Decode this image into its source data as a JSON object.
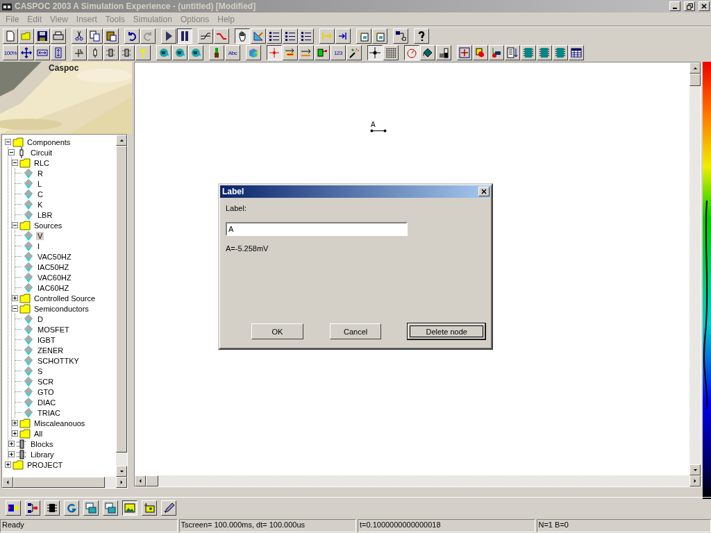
{
  "window": {
    "title": "CASPOC 2003 A Simulation Experience - (untitled) [Modified]"
  },
  "menu": [
    "File",
    "Edit",
    "View",
    "Insert",
    "Tools",
    "Simulation",
    "Options",
    "Help"
  ],
  "toolbar_rows": [
    {
      "groups": [
        {
          "buttons": [
            {
              "pressed": false
            },
            {
              "pressed": false
            },
            {
              "pressed": false
            },
            {
              "pressed": false
            }
          ]
        },
        {
          "buttons": [
            {
              "pressed": false
            },
            {
              "pressed": false
            },
            {
              "pressed": false
            }
          ]
        },
        {
          "buttons": [
            {
              "pressed": false
            },
            {
              "pressed": false
            }
          ]
        },
        {
          "buttons": [
            {
              "pressed": false
            },
            {
              "pressed": true
            }
          ]
        },
        {
          "buttons": [
            {
              "pressed": false
            },
            {
              "pressed": false
            }
          ]
        },
        {
          "buttons": [
            {
              "pressed": true
            },
            {
              "pressed": false
            },
            {
              "pressed": false
            },
            {
              "pressed": false
            },
            {
              "pressed": false
            }
          ]
        },
        {
          "buttons": [
            {
              "pressed": false
            },
            {
              "pressed": false
            }
          ]
        },
        {
          "buttons": [
            {
              "pressed": false
            },
            {
              "pressed": false
            }
          ]
        },
        {
          "buttons": [
            {
              "pressed": false
            }
          ]
        },
        {
          "buttons": [
            {
              "pressed": false
            }
          ]
        }
      ]
    },
    {
      "groups": [
        {
          "buttons": [
            {
              "pressed": false,
              "label": "100%"
            },
            {
              "pressed": false
            },
            {
              "pressed": false
            },
            {
              "pressed": false
            }
          ]
        },
        {
          "buttons": [
            {
              "pressed": false
            },
            {
              "pressed": false
            },
            {
              "pressed": false
            },
            {
              "pressed": false
            },
            {
              "pressed": false
            }
          ]
        },
        {
          "buttons": [
            {
              "pressed": false
            },
            {
              "pressed": false
            },
            {
              "pressed": false
            }
          ]
        },
        {
          "buttons": [
            {
              "pressed": false
            },
            {
              "pressed": false,
              "label": "Abc"
            }
          ]
        },
        {
          "buttons": [
            {
              "pressed": false
            }
          ]
        },
        {
          "buttons": [
            {
              "pressed": true
            },
            {
              "pressed": false
            },
            {
              "pressed": false
            },
            {
              "pressed": false
            },
            {
              "pressed": false,
              "label": "123"
            },
            {
              "pressed": false
            }
          ]
        },
        {
          "buttons": [
            {
              "pressed": true
            },
            {
              "pressed": false
            }
          ]
        },
        {
          "buttons": [
            {
              "pressed": true
            },
            {
              "pressed": false
            },
            {
              "pressed": false
            }
          ]
        },
        {
          "buttons": [
            {
              "pressed": false
            },
            {
              "pressed": false
            },
            {
              "pressed": false
            },
            {
              "pressed": false
            },
            {
              "pressed": false
            },
            {
              "pressed": false
            },
            {
              "pressed": false
            },
            {
              "pressed": false
            }
          ]
        }
      ]
    }
  ],
  "sidebar": {
    "title": "Caspoc",
    "tree": [
      {
        "label": "Components",
        "kind": "folder",
        "expanded": true,
        "selected": false,
        "children": [
          {
            "label": "Circuit",
            "kind": "circuit",
            "expanded": true,
            "selected": false,
            "children": [
              {
                "label": "RLC",
                "kind": "folder",
                "expanded": true,
                "selected": false,
                "children": [
                  {
                    "label": "R",
                    "kind": "component",
                    "selected": false
                  },
                  {
                    "label": "L",
                    "kind": "component",
                    "selected": false
                  },
                  {
                    "label": "C",
                    "kind": "component",
                    "selected": false
                  },
                  {
                    "label": "K",
                    "kind": "component",
                    "selected": false
                  },
                  {
                    "label": "LBR",
                    "kind": "component",
                    "selected": false
                  }
                ]
              },
              {
                "label": "Sources",
                "kind": "folder",
                "expanded": true,
                "selected": false,
                "children": [
                  {
                    "label": "V",
                    "kind": "component",
                    "selected": true
                  },
                  {
                    "label": "I",
                    "kind": "component",
                    "selected": false
                  },
                  {
                    "label": "VAC50HZ",
                    "kind": "component",
                    "selected": false
                  },
                  {
                    "label": "IAC50HZ",
                    "kind": "component",
                    "selected": false
                  },
                  {
                    "label": "VAC60HZ",
                    "kind": "component",
                    "selected": false
                  },
                  {
                    "label": "IAC60HZ",
                    "kind": "component",
                    "selected": false
                  }
                ]
              },
              {
                "label": "Controlled Source",
                "kind": "folder",
                "expanded": false,
                "selected": false
              },
              {
                "label": "Semiconductors",
                "kind": "folder",
                "expanded": true,
                "selected": false,
                "children": [
                  {
                    "label": "D",
                    "kind": "component",
                    "selected": false
                  },
                  {
                    "label": "MOSFET",
                    "kind": "component",
                    "selected": false
                  },
                  {
                    "label": "IGBT",
                    "kind": "component",
                    "selected": false
                  },
                  {
                    "label": "ZENER",
                    "kind": "component",
                    "selected": false
                  },
                  {
                    "label": "SCHOTTKY",
                    "kind": "component",
                    "selected": false
                  },
                  {
                    "label": "S",
                    "kind": "component",
                    "selected": false
                  },
                  {
                    "label": "SCR",
                    "kind": "component",
                    "selected": false
                  },
                  {
                    "label": "GTO",
                    "kind": "component",
                    "selected": false
                  },
                  {
                    "label": "DIAC",
                    "kind": "component",
                    "selected": false
                  },
                  {
                    "label": "TRIAC",
                    "kind": "component",
                    "selected": false
                  }
                ]
              },
              {
                "label": "Miscaleanouos",
                "kind": "folder",
                "expanded": false,
                "selected": false
              },
              {
                "label": "All",
                "kind": "folder",
                "expanded": false,
                "selected": false
              }
            ]
          },
          {
            "label": "Blocks",
            "kind": "block",
            "expanded": false,
            "selected": false
          },
          {
            "label": "Library",
            "kind": "library",
            "expanded": false,
            "selected": false
          }
        ]
      },
      {
        "label": "PROJECT",
        "kind": "folder",
        "expanded": false,
        "selected": false
      }
    ]
  },
  "canvas": {
    "nodes": [
      {
        "label": "A"
      }
    ]
  },
  "dialog": {
    "title": "Label",
    "field_label": "Label:",
    "value": "A",
    "reading": "A=-5.258mV",
    "buttons": [
      {
        "label": "OK",
        "default": false
      },
      {
        "label": "Cancel",
        "default": false
      },
      {
        "label": "Delete node",
        "default": true
      }
    ]
  },
  "bottom_toolbar": [
    {
      "pressed": false
    },
    {
      "pressed": false
    },
    {
      "pressed": false
    },
    {
      "pressed": false
    },
    {
      "pressed": false
    },
    {
      "pressed": false
    },
    {
      "pressed": true
    },
    {
      "pressed": false
    },
    {
      "pressed": false
    }
  ],
  "status_bar": [
    "Ready",
    "Tscreen= 100.000ms, dt= 100.000us",
    "t=0.1000000000000018",
    "N=1 B=0"
  ]
}
